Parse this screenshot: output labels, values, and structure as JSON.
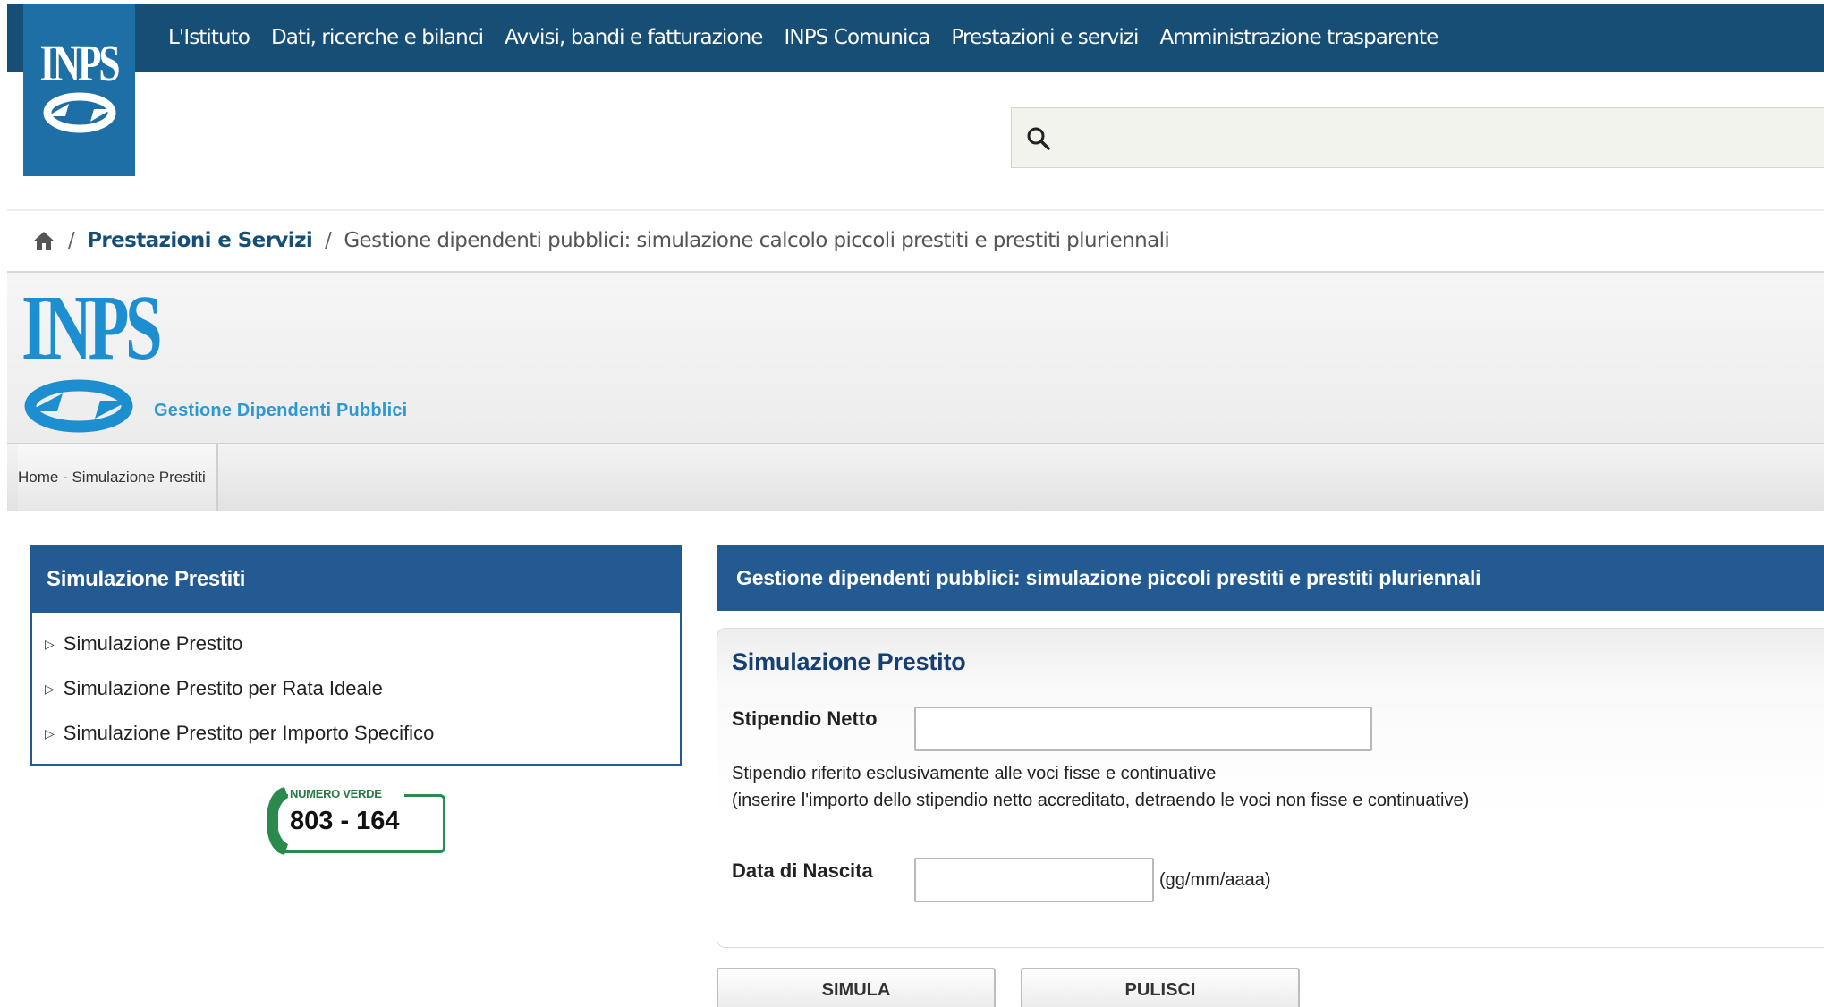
{
  "colors": {
    "top_nav_bg": "#174e75",
    "logo_bg": "#1d6fa5",
    "panel_header_bg": "#245a92",
    "accent_light_blue": "#2a9ad6",
    "numero_verde_green": "#2a8a4e"
  },
  "top_nav": {
    "logo_text": "INPS",
    "items": [
      "L'Istituto",
      "Dati, ricerche e bilanci",
      "Avvisi, bandi e fatturazione",
      "INPS Comunica",
      "Prestazioni e servizi",
      "Amministrazione trasparente"
    ]
  },
  "search": {
    "icon": "search-icon",
    "value": "",
    "placeholder": ""
  },
  "breadcrumb": {
    "home_icon": "home-icon",
    "separator": "/",
    "section": "Prestazioni e Servizi",
    "current": "Gestione dipendenti pubblici: simulazione calcolo piccoli prestiti e prestiti pluriennali"
  },
  "banner": {
    "logo_text": "INPS",
    "subtitle": "Gestione Dipendenti Pubblici"
  },
  "subnav": {
    "trail": "Home - Simulazione Prestiti"
  },
  "sidebar": {
    "title": "Simulazione Prestiti",
    "items": [
      {
        "label": "Simulazione Prestito",
        "icon": "triangle-right-icon"
      },
      {
        "label": "Simulazione Prestito per Rata Ideale",
        "icon": "triangle-right-icon"
      },
      {
        "label": "Simulazione Prestito per Importo Specifico",
        "icon": "triangle-right-icon"
      }
    ]
  },
  "numero_verde": {
    "label": "NUMERO VERDE",
    "number": "803 - 164"
  },
  "main": {
    "header": "Gestione dipendenti pubblici: simulazione piccoli prestiti e prestiti pluriennali",
    "form_title": "Simulazione Prestito",
    "stipendio": {
      "label": "Stipendio Netto",
      "value": "",
      "note_line1": "Stipendio riferito esclusivamente alle voci fisse e continuative",
      "note_line2": "(inserire l'importo dello stipendio netto accreditato, detraendo le voci non fisse e continuative)"
    },
    "data_nascita": {
      "label": "Data di Nascita",
      "value": "",
      "format_hint": "(gg/mm/aaaa)"
    },
    "buttons": {
      "simula": "SIMULA",
      "pulisci": "PULISCI"
    }
  }
}
